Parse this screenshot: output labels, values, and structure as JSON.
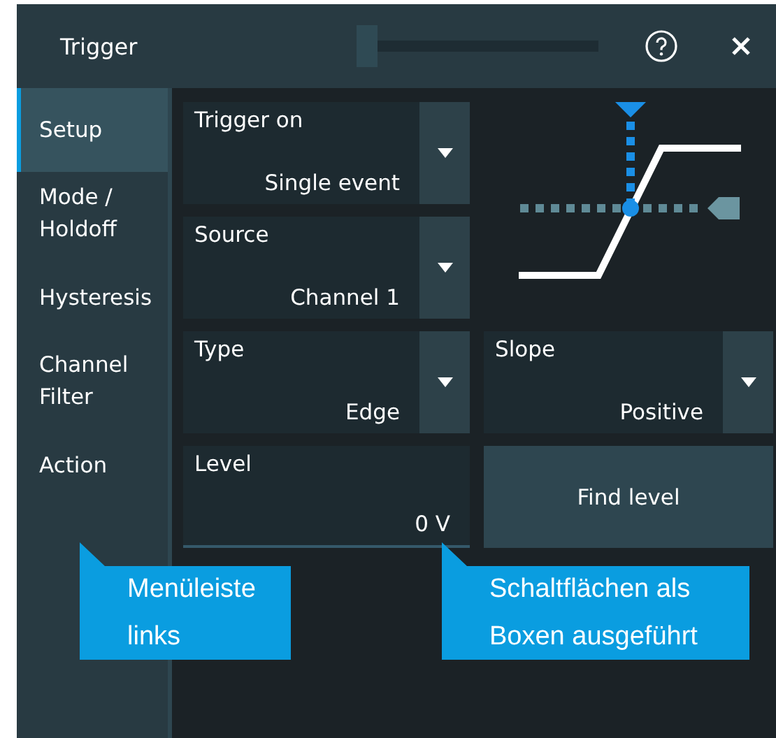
{
  "window": {
    "title": "Trigger"
  },
  "title_slider": {
    "level": 0
  },
  "sidebar": {
    "items": [
      {
        "label": "Setup",
        "selected": true
      },
      {
        "label": "Mode / Holdoff",
        "selected": false
      },
      {
        "label": "Hysteresis",
        "selected": false
      },
      {
        "label": "Channel Filter",
        "selected": false
      },
      {
        "label": "Action",
        "selected": false
      }
    ]
  },
  "rows": [
    [
      {
        "kind": "dropdown",
        "label": "Trigger on",
        "value": "Single event"
      }
    ],
    [
      {
        "kind": "dropdown",
        "label": "Source",
        "value": "Channel 1"
      }
    ],
    [
      {
        "kind": "dropdown",
        "label": "Type",
        "value": "Edge"
      },
      {
        "kind": "dropdown",
        "label": "Slope",
        "value": "Positive"
      }
    ],
    [
      {
        "kind": "input",
        "label": "Level",
        "value": "0 V"
      },
      {
        "kind": "button",
        "label": "Find level"
      }
    ]
  ],
  "callouts": [
    {
      "text": "Menüleiste links"
    },
    {
      "text": "Schaltflächen als Boxen ausgeführt"
    }
  ]
}
